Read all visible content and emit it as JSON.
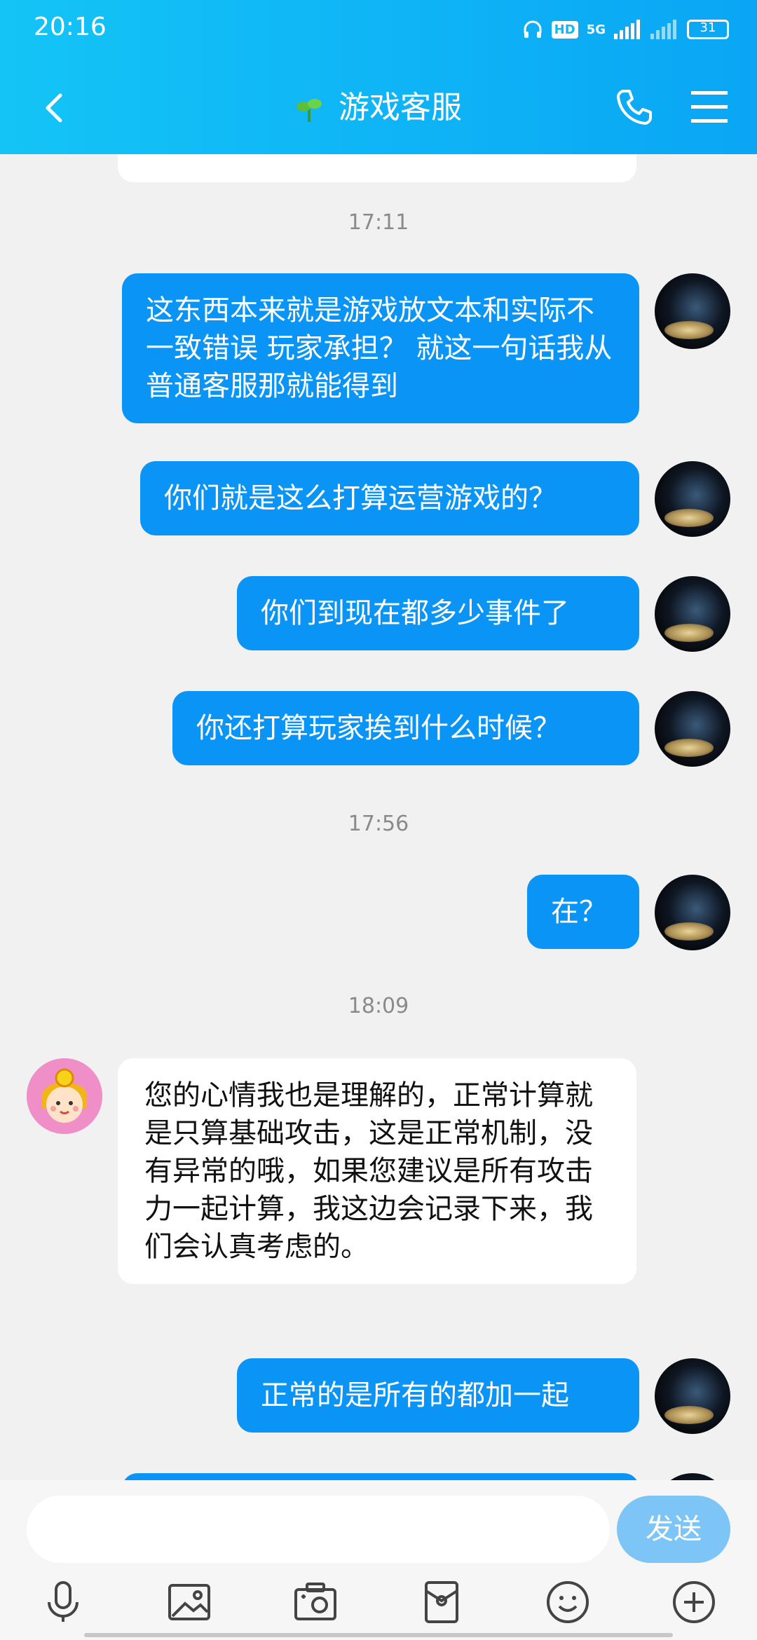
{
  "status_bar": {
    "time": "20:16",
    "network": "5G",
    "hd": "HD",
    "battery": "31"
  },
  "header": {
    "title": "游戏客服"
  },
  "chat": {
    "timestamps": [
      "17:11",
      "17:56",
      "18:09"
    ],
    "messages": [
      {
        "from": "me",
        "text": "这东西本来就是游戏放文本和实际不一致错误  玩家承担？  就这一句话我从普通客服那就能得到"
      },
      {
        "from": "me",
        "text": "你们就是这么打算运营游戏的？"
      },
      {
        "from": "me",
        "text": "你们到现在都多少事件了"
      },
      {
        "from": "me",
        "text": "你还打算玩家挨到什么时候？"
      },
      {
        "from": "me",
        "text": "在？"
      },
      {
        "from": "service",
        "text": "您的心情我也是理解的，正常计算就是只算基础攻击，这是正常机制，没有异常的哦，如果您建议是所有攻击力一起计算，我这边会记录下来，我们会认真考虑的。"
      },
      {
        "from": "me",
        "text": "正常的是所有的都加一起"
      }
    ]
  },
  "input": {
    "send_label": "发送"
  },
  "colors": {
    "header_start": "#14c4f6",
    "header_end": "#0aa6f5",
    "outgoing_bubble": "#0a95f6",
    "incoming_bubble": "#ffffff",
    "send_button": "#7dc5f6"
  },
  "toolbar_icons": [
    "mic-icon",
    "image-icon",
    "camera-icon",
    "red-packet-icon",
    "emoji-icon",
    "plus-icon"
  ]
}
